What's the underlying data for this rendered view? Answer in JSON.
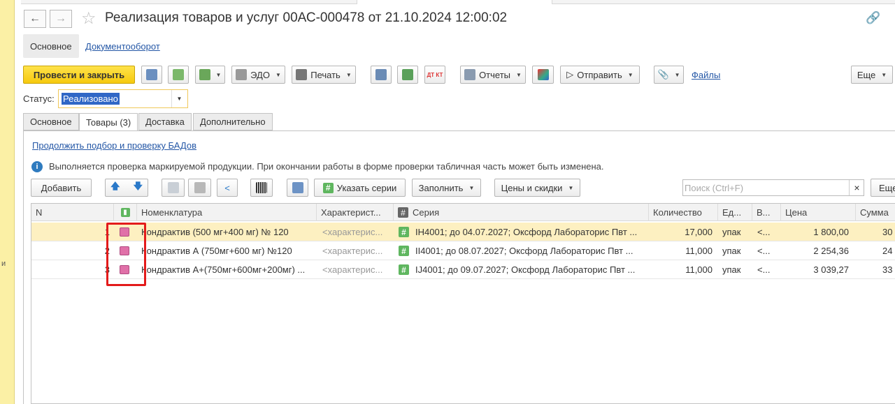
{
  "window": {
    "title": "Реализация товаров и услуг 00АС-000478 от 21.10.2024 12:00:02",
    "left_strip_text": "и"
  },
  "section_tabs": [
    {
      "label": "Основное",
      "active": true
    },
    {
      "label": "Документооборот",
      "active": false
    }
  ],
  "toolbar": {
    "post_close": "Провести и закрыть",
    "edo": "ЭДО",
    "print": "Печать",
    "reports": "Отчеты",
    "send": "Отправить",
    "files": "Файлы",
    "more": "Еще"
  },
  "status": {
    "label": "Статус:",
    "value": "Реализовано"
  },
  "tabs": [
    {
      "label": "Основное"
    },
    {
      "label": "Товары (3)",
      "active": true
    },
    {
      "label": "Доставка"
    },
    {
      "label": "Дополнительно"
    }
  ],
  "bad_link": "Продолжить подбор и проверку БАДов",
  "info_message": "Выполняется проверка маркируемой продукции. При окончании работы в форме проверки табличная часть может быть изменена.",
  "table_toolbar": {
    "add": "Добавить",
    "specify_series": "Указать серии",
    "fill": "Заполнить",
    "prices_discounts": "Цены и скидки",
    "search_placeholder": "Поиск (Ctrl+F)",
    "search_clear": "×",
    "more": "Еще"
  },
  "table": {
    "columns": {
      "n": "N",
      "nomenclature": "Номенклатура",
      "characteristic": "Характерист...",
      "series": "Серия",
      "quantity": "Количество",
      "unit": "Ед...",
      "v": "В...",
      "price": "Цена",
      "sum": "Сумма"
    },
    "rows": [
      {
        "n": "1",
        "nomenclature": "Кондрактив (500 мг+400 мг) № 120",
        "characteristic": "<характерис...",
        "series": "IH4001; до 04.07.2027; Оксфорд Лаборaторис Пвт ...",
        "quantity": "17,000",
        "unit": "упак",
        "v": "<...",
        "price": "1 800,00",
        "sum": "30",
        "selected": true
      },
      {
        "n": "2",
        "nomenclature": "Кондрактив А (750мг+600 мг) №120",
        "characteristic": "<характерис...",
        "series": "II4001; до 08.07.2027; Оксфорд Лаборaторис Пвт ...",
        "quantity": "11,000",
        "unit": "упак",
        "v": "<...",
        "price": "2 254,36",
        "sum": "24"
      },
      {
        "n": "3",
        "nomenclature": "Кондрактив А+(750мг+600мг+200мг) ...",
        "characteristic": "<характерис...",
        "series": "IJ4001; до 09.07.2027; Оксфорд Лаборaторис Пвт ...",
        "quantity": "11,000",
        "unit": "упак",
        "v": "<...",
        "price": "3 039,27",
        "sum": "33"
      }
    ]
  },
  "colors": {
    "accent": "#f6c90e",
    "link": "#2457a6",
    "highlight": "#e31b1b",
    "selected_row": "#fdf0c1"
  }
}
